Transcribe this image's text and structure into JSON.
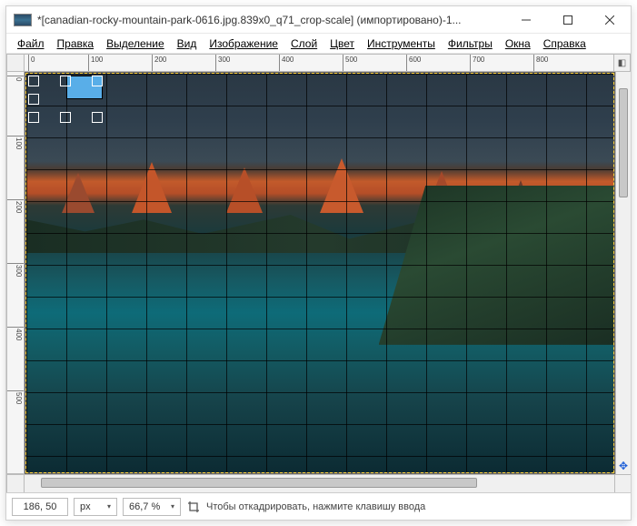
{
  "window": {
    "title": "*[canadian-rocky-mountain-park-0616.jpg.839x0_q71_crop-scale] (импортировано)-1..."
  },
  "menu": {
    "file": "Файл",
    "edit": "Правка",
    "select": "Выделение",
    "view": "Вид",
    "image": "Изображение",
    "layer": "Слой",
    "color": "Цвет",
    "tools": "Инструменты",
    "filters": "Фильтры",
    "windows": "Окна",
    "help": "Справка"
  },
  "ruler": {
    "h": [
      "0",
      "100",
      "200",
      "300",
      "400",
      "500",
      "600",
      "700",
      "800"
    ],
    "v": [
      "0",
      "100",
      "200",
      "300",
      "400",
      "500"
    ]
  },
  "status": {
    "coords": "186, 50",
    "unit": "px",
    "zoom": "66,7 %",
    "hint": "Чтобы откадрировать, нажмите клавишу ввода"
  }
}
